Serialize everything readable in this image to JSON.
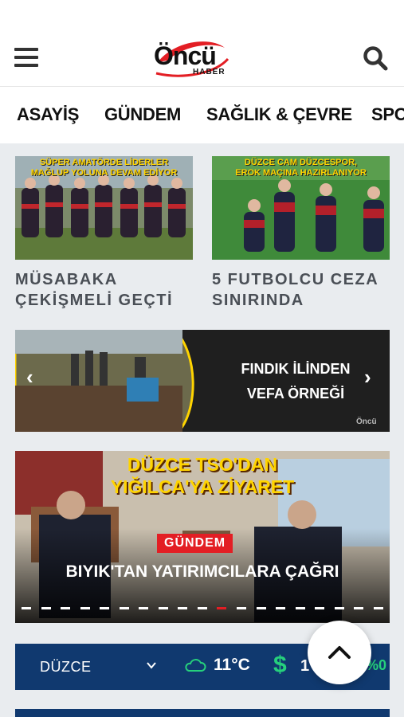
{
  "header": {
    "logo_text": "Öncü",
    "logo_sub": "HABER",
    "menu_icon": "hamburger-menu-icon",
    "search_icon": "search-icon"
  },
  "nav": {
    "items": [
      {
        "label": "ASAYİŞ"
      },
      {
        "label": "GÜNDEM"
      },
      {
        "label": "SAĞLIK & ÇEVRE"
      },
      {
        "label": "SPO"
      }
    ]
  },
  "cards": [
    {
      "banner_line1": "SÜPER AMATÖRDE LİDERLER",
      "banner_line2": "MAĞLUP YOLUNA DEVAM EDİYOR",
      "title": "MÜSABAKA ÇEKİŞMELİ GEÇTİ"
    },
    {
      "banner_line1": "DÜZCE CAM DÜZCESPOR,",
      "banner_line2": "EROK MAÇINA HAZIRLANIYOR",
      "title": "5 FUTBOLCU CEZA SINIRINDA"
    }
  ],
  "slider": {
    "line1": "FINDIK İLİNDEN",
    "line2": "VEFA ÖRNEĞİ",
    "watermark": "Öncü"
  },
  "hero": {
    "headline_line1": "DÜZCE TSO'DAN",
    "headline_line2": "YIĞILCA'YA ZİYARET",
    "badge": "GÜNDEM",
    "title": "BIYIK'TAN YATIRIMCILARA ÇAĞRI",
    "dots_total": 19,
    "active_dot": 10
  },
  "weather": {
    "city": "DÜZCE",
    "temperature": "11°C",
    "currency_symbol": "$",
    "currency_value": "1",
    "change": "%0",
    "accent": "#26d07c",
    "background": "#10396f"
  },
  "colors": {
    "badge_red": "#e31e24",
    "headline_yellow": "#ffd400"
  }
}
